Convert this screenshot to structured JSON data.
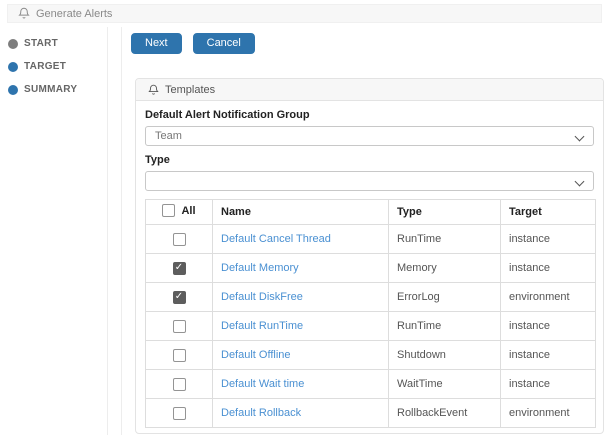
{
  "header": {
    "title": "Generate Alerts"
  },
  "wizard": {
    "steps": [
      {
        "label": "START",
        "state": "done"
      },
      {
        "label": "TARGET",
        "state": "active"
      },
      {
        "label": "SUMMARY",
        "state": "active"
      }
    ]
  },
  "actions": {
    "next_label": "Next",
    "cancel_label": "Cancel"
  },
  "panel": {
    "title": "Templates",
    "notification_group": {
      "label": "Default Alert Notification Group",
      "selected": "Team"
    },
    "type_filter": {
      "label": "Type",
      "selected": ""
    },
    "table": {
      "columns": [
        "All",
        "Name",
        "Type",
        "Target"
      ],
      "rows": [
        {
          "checked": false,
          "name": "Default Cancel Thread",
          "type": "RunTime",
          "target": "instance"
        },
        {
          "checked": true,
          "name": "Default Memory",
          "type": "Memory",
          "target": "instance"
        },
        {
          "checked": true,
          "name": "Default DiskFree",
          "type": "ErrorLog",
          "target": "environment"
        },
        {
          "checked": false,
          "name": "Default RunTime",
          "type": "RunTime",
          "target": "instance"
        },
        {
          "checked": false,
          "name": "Default Offline",
          "type": "Shutdown",
          "target": "instance"
        },
        {
          "checked": false,
          "name": "Default Wait time",
          "type": "WaitTime",
          "target": "instance"
        },
        {
          "checked": false,
          "name": "Default Rollback",
          "type": "RollbackEvent",
          "target": "environment"
        }
      ]
    }
  },
  "colors": {
    "primary": "#2e74ad",
    "link": "#4a90d2",
    "step_gray": "#7d7d7d",
    "checkbox_checked": "#5d5d5d"
  }
}
